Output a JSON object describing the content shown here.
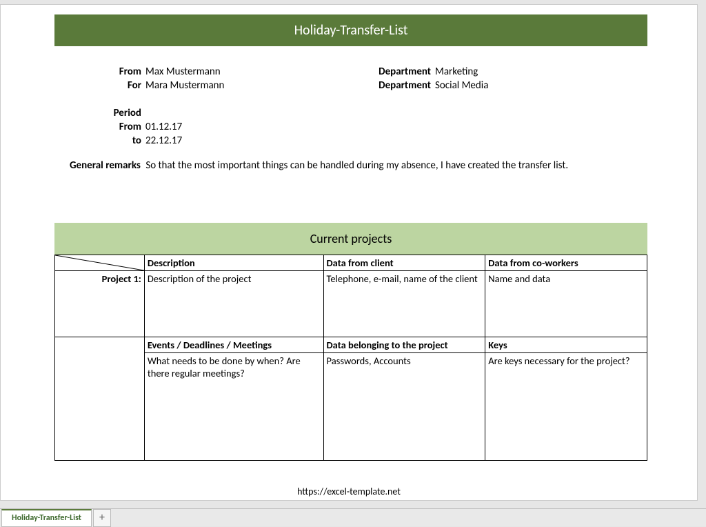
{
  "title": "Holiday-Transfer-List",
  "info": {
    "from_label": "From",
    "from_value": "Max Mustermann",
    "for_label": "For",
    "for_value": "Mara Mustermann",
    "dept1_label": "Department",
    "dept1_value": "Marketing",
    "dept2_label": "Department",
    "dept2_value": "Social Media",
    "period_label": "Period",
    "period_from_label": "From",
    "period_from_value": "01.12.17",
    "period_to_label": "to",
    "period_to_value": "22.12.17"
  },
  "remarks": {
    "label": "General remarks",
    "text": "So that the most important things can be handled during my absence, I have created the transfer list."
  },
  "section": {
    "header": "Current projects",
    "row1": {
      "label": "Project 1:",
      "h1": "Description",
      "h2": "Data from client",
      "h3": "Data from co-workers",
      "c1": "Description of the project",
      "c2": "Telephone, e-mail, name of the client",
      "c3": "Name and data"
    },
    "row2": {
      "h1": "Events / Deadlines / Meetings",
      "h2": "Data belonging to the project",
      "h3": "Keys",
      "c1": "What needs to be done by when? Are there regular meetings?",
      "c2": "Passwords, Accounts",
      "c3": "Are keys necessary for the project?"
    }
  },
  "footer_url": "https://excel-template.net",
  "tab": {
    "name": "Holiday-Transfer-List",
    "add": "+"
  }
}
